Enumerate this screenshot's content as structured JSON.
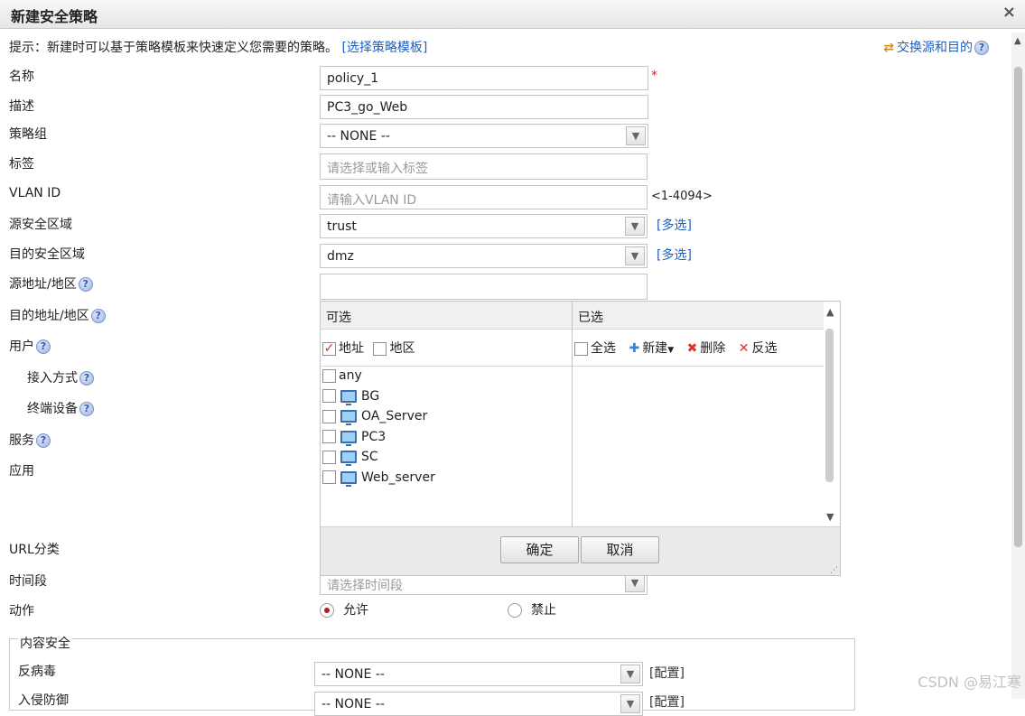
{
  "window": {
    "title": "新建安全策略",
    "close_icon": "×"
  },
  "hint": {
    "text": "提示：新建时可以基于策略模板来快速定义您需要的策略。",
    "link": "[选择策略模板]"
  },
  "swap": {
    "label": "交换源和目的"
  },
  "fields": {
    "name": {
      "label": "名称",
      "value": "policy_1",
      "required": "*"
    },
    "desc": {
      "label": "描述",
      "value": "PC3_go_Web"
    },
    "group": {
      "label": "策略组",
      "value": "-- NONE --"
    },
    "tag": {
      "label": "标签",
      "placeholder": "请选择或输入标签"
    },
    "vlan": {
      "label": "VLAN ID",
      "placeholder": "请输入VLAN ID",
      "range": "<1-4094>"
    },
    "src_zone": {
      "label": "源安全区域",
      "value": "trust",
      "multi": "[多选]"
    },
    "dst_zone": {
      "label": "目的安全区域",
      "value": "dmz",
      "multi": "[多选]"
    },
    "src_addr": {
      "label": "源地址/地区"
    },
    "dst_addr": {
      "label": "目的地址/地区"
    },
    "user": {
      "label": "用户"
    },
    "access": {
      "label": "接入方式"
    },
    "terminal": {
      "label": "终端设备"
    },
    "service": {
      "label": "服务"
    },
    "app": {
      "label": "应用"
    },
    "url": {
      "label": "URL分类"
    },
    "time": {
      "label": "时间段",
      "placeholder": "请选择时间段"
    },
    "action": {
      "label": "动作",
      "allow": "允许",
      "deny": "禁止"
    }
  },
  "dropdown": {
    "available_header": "可选",
    "selected_header": "已选",
    "filter_address": "地址",
    "filter_region": "地区",
    "select_all": "全选",
    "new": "新建",
    "delete": "删除",
    "invert": "反选",
    "items": [
      "any",
      "BG",
      "OA_Server",
      "PC3",
      "SC",
      "Web_server"
    ],
    "ok": "确定",
    "cancel": "取消"
  },
  "content_security": {
    "legend": "内容安全",
    "antivirus": {
      "label": "反病毒",
      "value": "-- NONE --",
      "config": "[配置]"
    },
    "ips": {
      "label": "入侵防御",
      "value": "-- NONE --",
      "config": "[配置]"
    }
  },
  "watermark": "CSDN @易江寒",
  "colors": {
    "link": "#1f5fbf",
    "required": "#e02020",
    "radio_on": "#b01e1e"
  }
}
